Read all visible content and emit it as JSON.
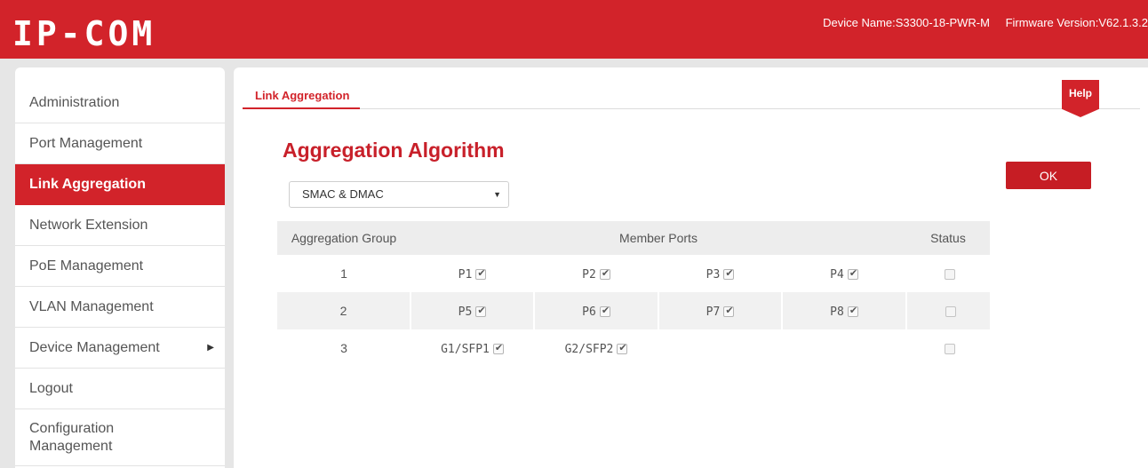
{
  "header": {
    "logo": "IP-COM",
    "device_name": "Device Name:S3300-18-PWR-M",
    "firmware_version": "Firmware Version:V62.1.3.2"
  },
  "sidebar": {
    "items": [
      {
        "label": "Administration"
      },
      {
        "label": "Port Management"
      },
      {
        "label": "Link Aggregation",
        "active": true
      },
      {
        "label": "Network Extension"
      },
      {
        "label": "PoE Management"
      },
      {
        "label": "VLAN Management"
      },
      {
        "label": "Device Management",
        "has_submenu": true
      },
      {
        "label": "Logout"
      },
      {
        "label": "Configuration Management"
      }
    ]
  },
  "main": {
    "tab": "Link Aggregation",
    "help_label": "Help",
    "section_title": "Aggregation Algorithm",
    "ok_label": "OK",
    "algorithm": {
      "selected": "SMAC & DMAC"
    },
    "table": {
      "headers": [
        "Aggregation Group",
        "Member Ports",
        "Status"
      ],
      "rows": [
        {
          "group": "1",
          "ports": [
            {
              "name": "P1",
              "checked": true
            },
            {
              "name": "P2",
              "checked": true
            },
            {
              "name": "P3",
              "checked": true
            },
            {
              "name": "P4",
              "checked": true
            }
          ],
          "status_checked": false
        },
        {
          "group": "2",
          "ports": [
            {
              "name": "P5",
              "checked": true
            },
            {
              "name": "P6",
              "checked": true
            },
            {
              "name": "P7",
              "checked": true
            },
            {
              "name": "P8",
              "checked": true
            }
          ],
          "status_checked": false
        },
        {
          "group": "3",
          "ports": [
            {
              "name": "G1/SFP1",
              "checked": true
            },
            {
              "name": "G2/SFP2",
              "checked": true
            }
          ],
          "status_checked": false
        }
      ]
    }
  },
  "colors": {
    "brand_red": "#d2232a",
    "backdrop": "#e6e6e6"
  }
}
